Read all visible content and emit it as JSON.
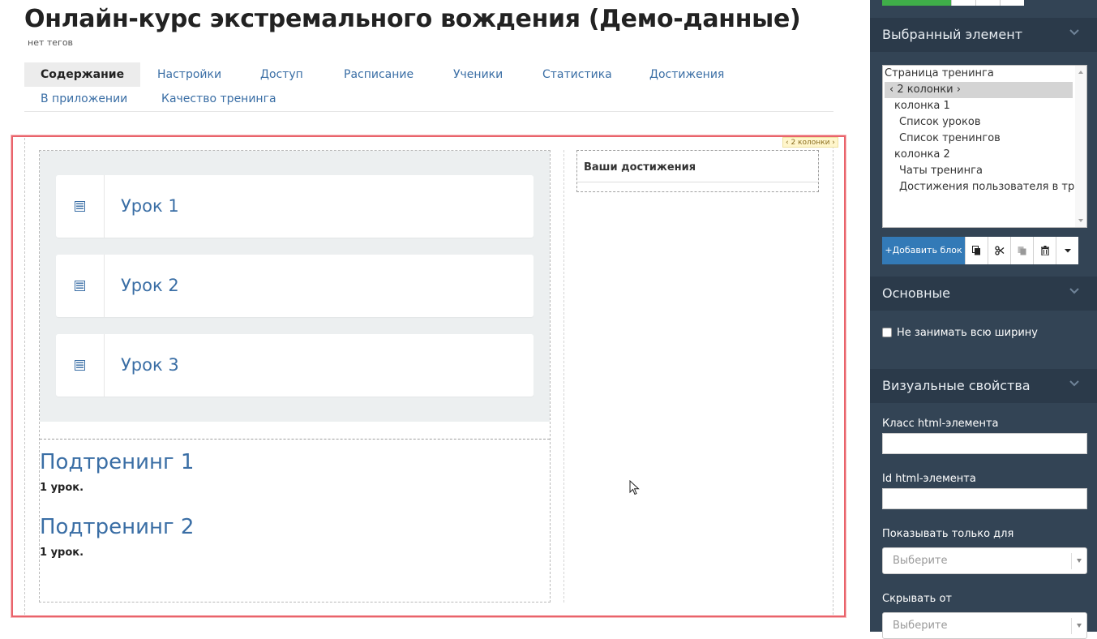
{
  "page": {
    "title": "Онлайн-курс экстремального вождения (Демо-данные)",
    "tags": "нет тегов"
  },
  "tabs": [
    {
      "label": "Содержание"
    },
    {
      "label": "Настройки"
    },
    {
      "label": "Доступ"
    },
    {
      "label": "Расписание"
    },
    {
      "label": "Ученики"
    },
    {
      "label": "Статистика"
    },
    {
      "label": "Достижения"
    },
    {
      "label": "В приложении"
    },
    {
      "label": "Качество тренинга"
    }
  ],
  "canvas": {
    "selected_tag": "‹ 2 колонки ›",
    "lessons": [
      {
        "title": "Урок 1",
        "icon": "lesson-list-icon"
      },
      {
        "title": "Урок 2",
        "icon": "lesson-list-icon"
      },
      {
        "title": "Урок 3",
        "icon": "lesson-list-icon"
      }
    ],
    "subtrainings": [
      {
        "title": "Подтренинг 1",
        "count": "1 урок."
      },
      {
        "title": "Подтренинг 2",
        "count": "1 урок."
      }
    ],
    "achievements_title": "Ваши достижения"
  },
  "panel": {
    "selected_section": "Выбранный элемент",
    "tree": [
      {
        "label": "Страница тренинга"
      },
      {
        "label": "‹ 2 колонки ›"
      },
      {
        "label": "колонка 1"
      },
      {
        "label": "Список уроков"
      },
      {
        "label": "Список тренингов"
      },
      {
        "label": "колонка 2"
      },
      {
        "label": "Чаты тренинга"
      },
      {
        "label": "Достижения пользователя в тре"
      }
    ],
    "add_block": "+Добавить блок",
    "main_section": "Основные",
    "full_width_label": "Не занимать всю ширину",
    "visual_section": "Визуальные свойства",
    "class_label": "Класс html-элемента",
    "class_value": "",
    "id_label": "Id html-элемента",
    "id_value": "",
    "show_only_label": "Показывать только для",
    "show_only_placeholder": "Выберите",
    "hide_from_label": "Скрывать от",
    "hide_from_placeholder": "Выберите"
  },
  "colors": {
    "accent": "#337ab7",
    "link": "#3a6ea5",
    "panel_bg": "#334455",
    "selection_frame": "#e9636b",
    "success": "#3fae49"
  }
}
